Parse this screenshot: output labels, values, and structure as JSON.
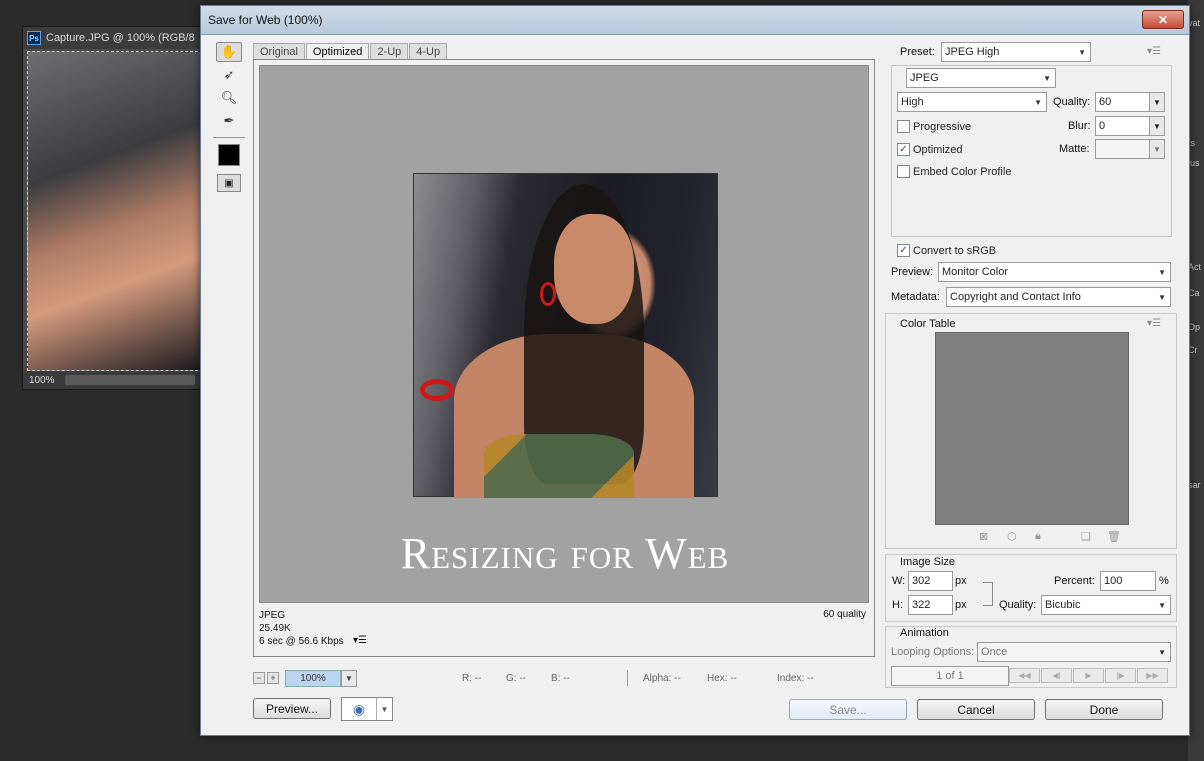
{
  "background_doc": {
    "title": "Capture.JPG @ 100% (RGB/8",
    "zoom": "100%",
    "ps_badge": "Ps"
  },
  "right_strip": [
    "vat",
    "ts",
    "jus",
    "Act",
    "Ca",
    "Op",
    "Cr",
    "sar"
  ],
  "dialog": {
    "title": "Save for Web (100%)",
    "close_label": "✕"
  },
  "tabs": [
    "Original",
    "Optimized",
    "2-Up",
    "4-Up"
  ],
  "preview": {
    "watermark": "Resizing for Web",
    "format": "JPEG",
    "size": "25.49K",
    "download_time": "6 sec @ 56.6 Kbps",
    "quality_label": "60 quality",
    "menu_glyph": "▾☰"
  },
  "zoom_bar": {
    "minus": "−",
    "plus": "+",
    "zoom": "100%",
    "r": "R: --",
    "g": "G: --",
    "b": "B: --",
    "alpha": "Alpha: --",
    "hex": "Hex: --",
    "index": "Index: --"
  },
  "buttons": {
    "preview": "Preview...",
    "save": "Save...",
    "cancel": "Cancel",
    "done": "Done"
  },
  "settings": {
    "preset_label": "Preset:",
    "preset_value": "JPEG High",
    "format_value": "JPEG",
    "quality_preset": "High",
    "quality_label": "Quality:",
    "quality_value": "60",
    "progressive_label": "Progressive",
    "blur_label": "Blur:",
    "blur_value": "0",
    "optimized_label": "Optimized",
    "matte_label": "Matte:",
    "embed_label": "Embed Color Profile",
    "convert_label": "Convert to sRGB",
    "preview_label": "Preview:",
    "preview_value": "Monitor Color",
    "metadata_label": "Metadata:",
    "metadata_value": "Copyright and Contact Info"
  },
  "checkboxes": {
    "progressive": false,
    "optimized": true,
    "embed": false,
    "convert": true
  },
  "color_table": {
    "label": "Color Table",
    "swatch_color": "#808080"
  },
  "image_size": {
    "label": "Image Size",
    "w_label": "W:",
    "w_value": "302",
    "h_label": "H:",
    "h_value": "322",
    "unit": "px",
    "percent_label": "Percent:",
    "percent_value": "100",
    "percent_unit": "%",
    "quality_label": "Quality:",
    "quality_value": "Bicubic"
  },
  "animation": {
    "label": "Animation",
    "looping_label": "Looping Options:",
    "looping_value": "Once",
    "frame": "1 of 1"
  }
}
